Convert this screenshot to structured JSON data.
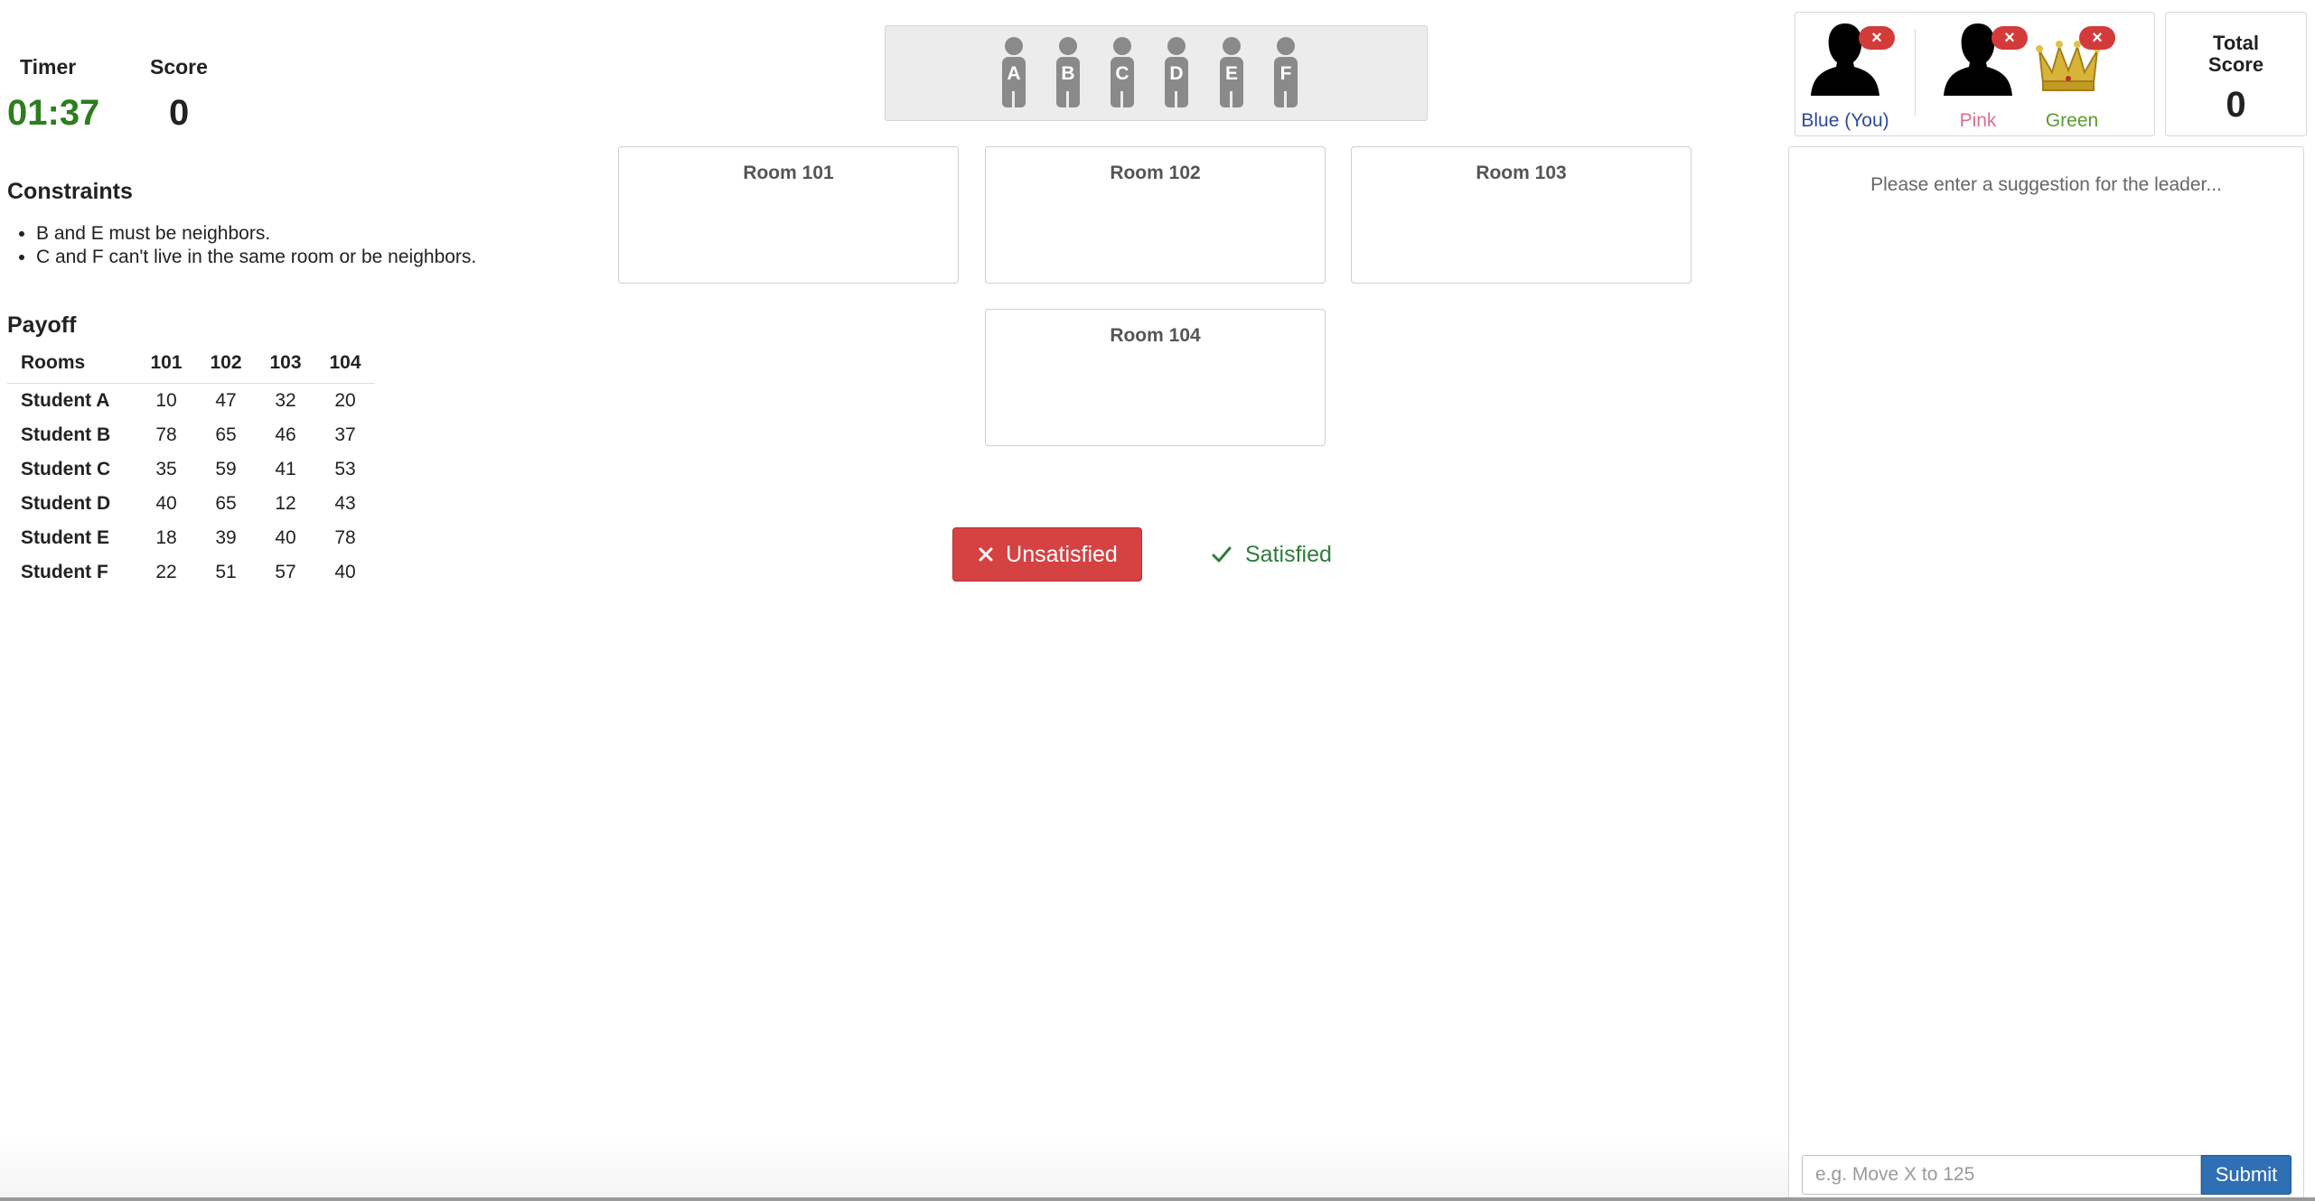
{
  "header": {
    "timer_label": "Timer",
    "timer_value": "01:37",
    "score_label": "Score",
    "score_value": "0"
  },
  "constraints": {
    "title": "Constraints",
    "items": [
      "B and E must be neighbors.",
      "C and F can't live in the same room or be neighbors."
    ]
  },
  "payoff": {
    "title": "Payoff",
    "columns": [
      "Rooms",
      "101",
      "102",
      "103",
      "104"
    ],
    "rows": [
      {
        "name": "Student A",
        "values": [
          "10",
          "47",
          "32",
          "20"
        ]
      },
      {
        "name": "Student B",
        "values": [
          "78",
          "65",
          "46",
          "37"
        ]
      },
      {
        "name": "Student C",
        "values": [
          "35",
          "59",
          "41",
          "53"
        ]
      },
      {
        "name": "Student D",
        "values": [
          "40",
          "65",
          "12",
          "43"
        ]
      },
      {
        "name": "Student E",
        "values": [
          "18",
          "39",
          "40",
          "78"
        ]
      },
      {
        "name": "Student F",
        "values": [
          "22",
          "51",
          "57",
          "40"
        ]
      }
    ]
  },
  "students": [
    "A",
    "B",
    "C",
    "D",
    "E",
    "F"
  ],
  "rooms": [
    "Room 101",
    "Room 102",
    "Room 103",
    "Room 104"
  ],
  "actions": {
    "unsatisfied_label": "Unsatisfied",
    "satisfied_label": "Satisfied"
  },
  "players": [
    {
      "name": "Blue (You)",
      "color": "#2b4a9a",
      "icon": "person-silhouette-icon"
    },
    {
      "name": "Pink",
      "color": "#e06b8c",
      "icon": "person-silhouette-icon"
    },
    {
      "name": "Green",
      "color": "#5a9a2e",
      "icon": "crown-icon"
    }
  ],
  "total": {
    "label_line1": "Total",
    "label_line2": "Score",
    "value": "0"
  },
  "chat": {
    "hint": "Please enter a suggestion for the leader...",
    "placeholder": "e.g. Move X to 125",
    "submit_label": "Submit"
  }
}
